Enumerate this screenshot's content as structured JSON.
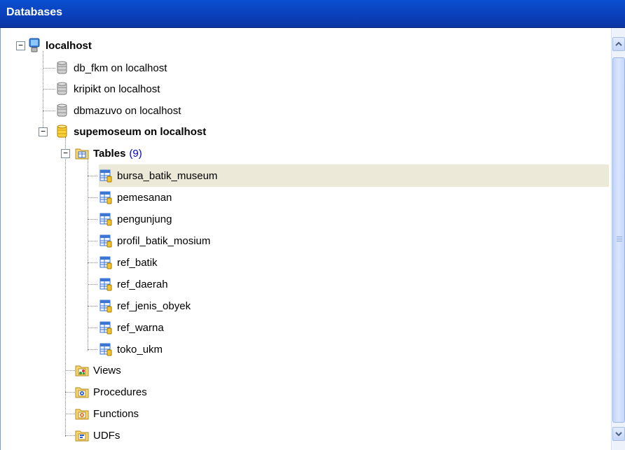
{
  "panel": {
    "title": "Databases"
  },
  "tree": {
    "server": "localhost",
    "databases": [
      "db_fkm on localhost",
      "kripikt on localhost",
      "dbmazuvo on localhost"
    ],
    "active_database": "supemoseum on localhost",
    "tables_label": "Tables",
    "tables_count": "(9)",
    "tables": [
      "bursa_batik_museum",
      "pemesanan",
      "pengunjung",
      "profil_batik_mosium",
      "ref_batik",
      "ref_daerah",
      "ref_jenis_obyek",
      "ref_warna",
      "toko_ukm"
    ],
    "folders": [
      "Views",
      "Procedures",
      "Functions",
      "UDFs"
    ],
    "selected_table": "bursa_batik_museum"
  },
  "icons": {
    "server": "server-monitor-icon",
    "database": "database-cylinder-icon",
    "tables_folder": "tables-folder-icon",
    "table": "table-grid-icon",
    "views": "views-folder-icon",
    "procedures": "procedures-folder-icon",
    "functions": "functions-folder-icon",
    "udfs": "udfs-folder-icon"
  },
  "colors": {
    "title_bar": "#0a4fd0",
    "selection": "#ece9d8",
    "count": "#0000cc"
  }
}
